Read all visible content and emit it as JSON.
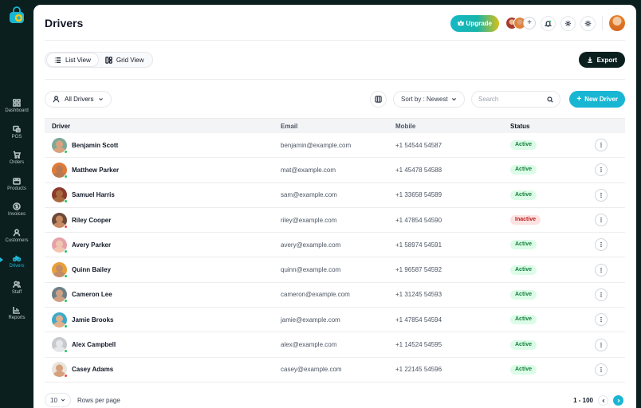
{
  "sidebar": {
    "items": [
      {
        "label": "Dashboard",
        "icon": "grid-icon",
        "active": false
      },
      {
        "label": "POS",
        "icon": "pos-icon",
        "active": false
      },
      {
        "label": "Orders",
        "icon": "cart-icon",
        "active": false
      },
      {
        "label": "Products",
        "icon": "box-icon",
        "active": false
      },
      {
        "label": "Invoices",
        "icon": "dollar-icon",
        "active": false
      },
      {
        "label": "Customers",
        "icon": "user-icon",
        "active": false
      },
      {
        "label": "Drivers",
        "icon": "bicycle-icon",
        "active": true
      },
      {
        "label": "Staff",
        "icon": "users-icon",
        "active": false
      },
      {
        "label": "Reports",
        "icon": "chart-icon",
        "active": false
      }
    ]
  },
  "header": {
    "title": "Drivers",
    "upgrade_label": "Upgrade",
    "add_avatar_label": "+"
  },
  "toolbar": {
    "list_view_label": "List View",
    "grid_view_label": "Grid View",
    "export_label": "Export",
    "filter_label": "All Drivers",
    "sort_label": "Sort by : Newest",
    "search_placeholder": "Search",
    "new_label": "New Driver"
  },
  "table": {
    "headers": {
      "driver": "Driver",
      "email": "Email",
      "mobile": "Mobile",
      "status": "Status"
    },
    "rows": [
      {
        "name": "Benjamin Scott",
        "email": "benjamin@example.com",
        "mobile": "+1 54544 54587",
        "status": "Active",
        "online": "#22c55e",
        "skin": "#d9a27e",
        "bg": "#7fa896"
      },
      {
        "name": "Matthew Parker",
        "email": "mat@example.com",
        "mobile": "+1 45478 54588",
        "status": "Active",
        "online": "#22c55e",
        "skin": "#b8794f",
        "bg": "#e07b39"
      },
      {
        "name": "Samuel Harris",
        "email": "sam@example.com",
        "mobile": "+1 33658 54589",
        "status": "Active",
        "online": "#22c55e",
        "skin": "#a8693f",
        "bg": "#8b3a2b"
      },
      {
        "name": "Riley Cooper",
        "email": "riley@example.com",
        "mobile": "+1 47854 54590",
        "status": "Inactive",
        "online": "#ef4444",
        "skin": "#c88a62",
        "bg": "#6b4a3a"
      },
      {
        "name": "Avery Parker",
        "email": "avery@example.com",
        "mobile": "+1 58974 54591",
        "status": "Active",
        "online": "#22c55e",
        "skin": "#f0c6b0",
        "bg": "#e5a0a8"
      },
      {
        "name": "Quinn Bailey",
        "email": "quinn@example.com",
        "mobile": "+1 96587 54592",
        "status": "Active",
        "online": "#22c55e",
        "skin": "#c28d66",
        "bg": "#e8a03a"
      },
      {
        "name": "Cameron Lee",
        "email": "cameron@example.com",
        "mobile": "+1 31245 54593",
        "status": "Active",
        "online": "#22c55e",
        "skin": "#cfa184",
        "bg": "#6e7f86"
      },
      {
        "name": "Jamie Brooks",
        "email": "jamie@example.com",
        "mobile": "+1 47854 54594",
        "status": "Active",
        "online": "#22c55e",
        "skin": "#e1b08c",
        "bg": "#3fa9c9"
      },
      {
        "name": "Alex Campbell",
        "email": "alex@example.com",
        "mobile": "+1 14524 54595",
        "status": "Active",
        "online": "#22c55e",
        "skin": "#e5e7eb",
        "bg": "#c7c9cc"
      },
      {
        "name": "Casey Adams",
        "email": "casey@example.com",
        "mobile": "+1 22145 54596",
        "status": "Active",
        "online": "#ef4444",
        "skin": "#d7a07c",
        "bg": "#e9e4de"
      }
    ]
  },
  "footer": {
    "per_page_value": "10",
    "per_page_label": "Rows per page",
    "range_label": "1 - 100"
  },
  "colors": {
    "accent": "#19b6d3",
    "dark": "#0b1f1f",
    "active_bg": "#dcfce7",
    "active_text": "#15803d",
    "inactive_bg": "#fee2e2",
    "inactive_text": "#b91c1c"
  }
}
